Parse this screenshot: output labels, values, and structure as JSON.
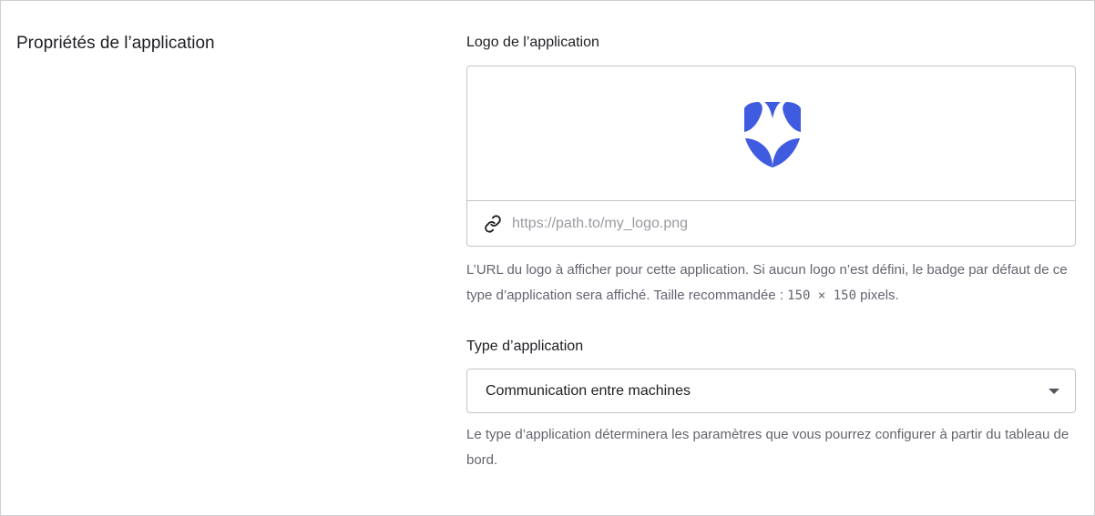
{
  "section": {
    "title": "Propriétés de l’application"
  },
  "logo": {
    "label": "Logo de l’application",
    "url_placeholder": "https://path.to/my_logo.png",
    "url_value": "",
    "help_part1": "L’URL du logo à afficher pour cette application. Si aucun logo n’est défini, le badge par défaut de ce type d’application sera affiché. Taille recommandée : ",
    "help_mono": "150 × 150",
    "help_part2": " pixels.",
    "badge_color": "#3f5be0",
    "icon": "shield-logo-icon"
  },
  "app_type": {
    "label": "Type d’application",
    "selected": "Communication entre machines",
    "help": "Le type d’application déterminera les paramètres que vous pourrez configurer à partir du tableau de bord."
  },
  "icons": {
    "url": "link-icon",
    "dropdown": "caret-down-icon"
  }
}
